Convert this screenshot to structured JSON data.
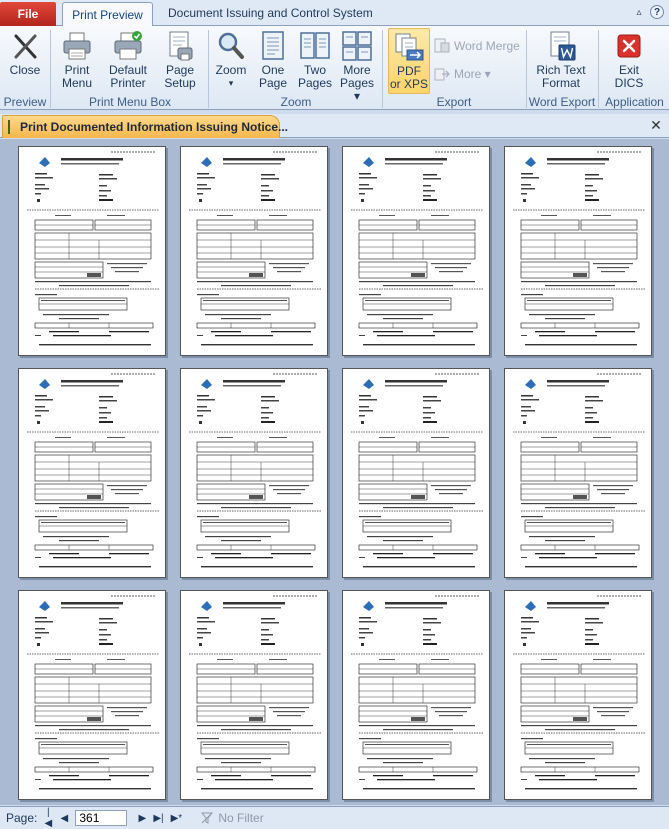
{
  "tabs": {
    "file": "File",
    "print_preview": "Print Preview"
  },
  "app_title": "Document Issuing and Control System",
  "window_controls": [
    "▵",
    "?",
    "✕"
  ],
  "ribbon": {
    "close": "Close",
    "print_menu": "Print\nMenu",
    "default_printer": "Default\nPrinter",
    "page_setup": "Page\nSetup",
    "zoom": "Zoom",
    "zoom_caret": "▾",
    "one_page": "One\nPage",
    "two_pages": "Two\nPages",
    "more_pages": "More\nPages ▾",
    "pdf_xps": "PDF\nor XPS",
    "word_merge": "Word Merge",
    "more": "More ▾",
    "rich_text": "Rich Text\nFormat",
    "exit_dics": "Exit\nDICS",
    "groups": {
      "preview": "Preview",
      "print_menu_box": "Print Menu Box",
      "zoom": "Zoom",
      "export": "Export",
      "word_export": "Word Export",
      "application": "Application"
    }
  },
  "object_tab": {
    "title": "Print Documented Information Issuing Notice..."
  },
  "page_count": 12,
  "statusbar": {
    "page_label": "Page:",
    "page_value": "361",
    "no_filter": "No Filter"
  },
  "colors": {
    "file_tab": "#c8302a",
    "active_button": "#fbd46b",
    "preview_bg": "#a9bad2"
  }
}
